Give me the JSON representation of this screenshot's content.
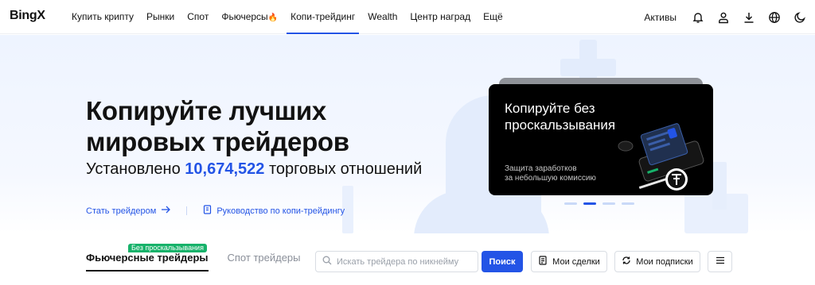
{
  "header": {
    "logo": "BingX",
    "nav": [
      {
        "label": "Купить крипту"
      },
      {
        "label": "Рынки"
      },
      {
        "label": "Спот"
      },
      {
        "label": "Фьючерсы",
        "icon": "fire-icon"
      },
      {
        "label": "Копи-трейдинг",
        "active": true
      },
      {
        "label": "Wealth"
      },
      {
        "label": "Центр наград"
      },
      {
        "label": "Ещё"
      }
    ],
    "assets_label": "Активы",
    "icons": [
      "bell-icon",
      "user-icon",
      "download-icon",
      "globe-icon",
      "moon-icon"
    ]
  },
  "hero": {
    "title_line1": "Копируйте лучших",
    "title_line2": "мировых трейдеров",
    "subtitle_prefix": "Установлено",
    "subtitle_number": "10,674,522",
    "subtitle_suffix": "торговых отношений",
    "link_become_trader": "Стать трейдером",
    "link_guide": "Руководство по копи-трейдингу"
  },
  "banner": {
    "title_line1": "Копируйте без",
    "title_line2": "проскальзывания",
    "note_line1": "Защита заработков",
    "note_line2": "за небольшую комиссию",
    "slides_total": 4,
    "active_slide": 2
  },
  "tabs": {
    "futures": "Фьючерсные трейдеры",
    "spot": "Спот трейдеры",
    "badge": "Без проскальзывания"
  },
  "search": {
    "placeholder": "Искать трейдера по никнейму",
    "button": "Поиск"
  },
  "buttons": {
    "my_deals": "Мои сделки",
    "my_subscriptions": "Мои подписки"
  },
  "colors": {
    "accent": "#2354e6",
    "badge": "#17b26a",
    "hero_bg": "#eef4ff"
  }
}
